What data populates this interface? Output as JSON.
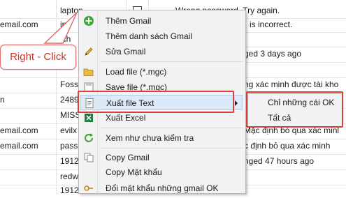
{
  "grid_rows": [
    {
      "col1": "",
      "col2": "laptop",
      "col3": "Wrong password. Try again.",
      "checkbox": true
    },
    {
      "col1": "email.com",
      "col2": "in",
      "col3": "is incorrect.",
      "checkbox": false
    },
    {
      "col1": "",
      "col2": "ich",
      "col3": "",
      "checkbox": false
    },
    {
      "col1": "",
      "col2": "",
      "col3": "ged 3 days ago",
      "checkbox": false
    },
    {
      "col1": "",
      "col2": "",
      "col3": "",
      "checkbox": false
    },
    {
      "col1": "",
      "col2": "Fossi",
      "col3": "ng xác minh được tài kho",
      "checkbox": false
    },
    {
      "col1": "n",
      "col2": "2489",
      "col3": "",
      "checkbox": false
    },
    {
      "col1": "",
      "col2": "MISS",
      "col3": "",
      "checkbox": false
    },
    {
      "col1": "email.com",
      "col2": "evilx",
      "col3": "Mặc định bỏ qua xác minl",
      "checkbox": false
    },
    {
      "col1": "email.com",
      "col2": "passp",
      "col3": "c định bỏ qua xác minh",
      "checkbox": false
    },
    {
      "col1": "",
      "col2": "1912",
      "col3": "nged 47 hours ago",
      "checkbox": false
    },
    {
      "col1": "",
      "col2": "redw",
      "col3": "",
      "checkbox": false
    },
    {
      "col1": "",
      "col2": "1912",
      "col3": "",
      "checkbox": false
    }
  ],
  "callout": {
    "text": "Right - Click"
  },
  "context_menu": {
    "items": [
      {
        "name": "add-gmail",
        "label": "Thêm Gmail",
        "icon": "green-plus-icon"
      },
      {
        "name": "add-gmail-list",
        "label": "Thêm danh sách Gmail",
        "icon": "none"
      },
      {
        "name": "edit-gmail",
        "label": "Sửa Gmail",
        "icon": "pencil-icon"
      },
      {
        "name": "load-file",
        "label": "Load file (*.mgc)",
        "icon": "folder-open-icon"
      },
      {
        "name": "save-file",
        "label": "Save file (*.mgc)",
        "icon": "save-icon"
      },
      {
        "name": "export-text",
        "label": "Xuất file Text",
        "icon": "text-file-icon",
        "submenu": true
      },
      {
        "name": "export-excel",
        "label": "Xuất Excel",
        "icon": "excel-icon"
      },
      {
        "name": "mark-unchecked",
        "label": "Xem như chưa kiểm tra",
        "icon": "refresh-icon"
      },
      {
        "name": "copy-gmail",
        "label": "Copy Gmail",
        "icon": "copy-icon"
      },
      {
        "name": "copy-password",
        "label": "Copy Mật khẩu",
        "icon": "none"
      },
      {
        "name": "change-password",
        "label": "Đổi mật khẩu những gmail OK",
        "icon": "key-icon"
      }
    ]
  },
  "submenu": {
    "items": [
      {
        "label": "Chỉ những cái OK"
      },
      {
        "label": "Tất cả"
      }
    ]
  },
  "colors": {
    "highlight_frame": "#d9403a",
    "menu_bg": "#f2f2f2",
    "hover_bg": "#dbe9f9"
  }
}
